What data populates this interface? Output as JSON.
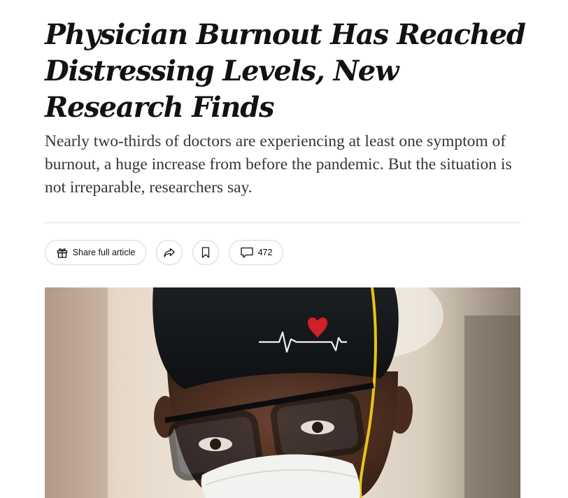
{
  "article": {
    "headline": "Physician Burnout Has Reached Distressing Levels, New Research Finds",
    "summary": "Nearly two-thirds of doctors are experiencing at least one symptom of burnout, a huge increase from before the pandemic. But the situation is not irreparable, researchers say."
  },
  "toolbar": {
    "share_label": "Share full article",
    "comment_count": "472",
    "share_icon": "gift-icon",
    "forward_icon": "share-arrow-icon",
    "save_icon": "bookmark-icon",
    "comments_icon": "comment-bubble-icon"
  },
  "photo": {
    "subject": "doctor-in-scrub-cap-and-mask"
  },
  "colors": {
    "text": "#121212",
    "summary_text": "#363636",
    "border": "#dfdfdf",
    "heart": "#d0202a"
  }
}
